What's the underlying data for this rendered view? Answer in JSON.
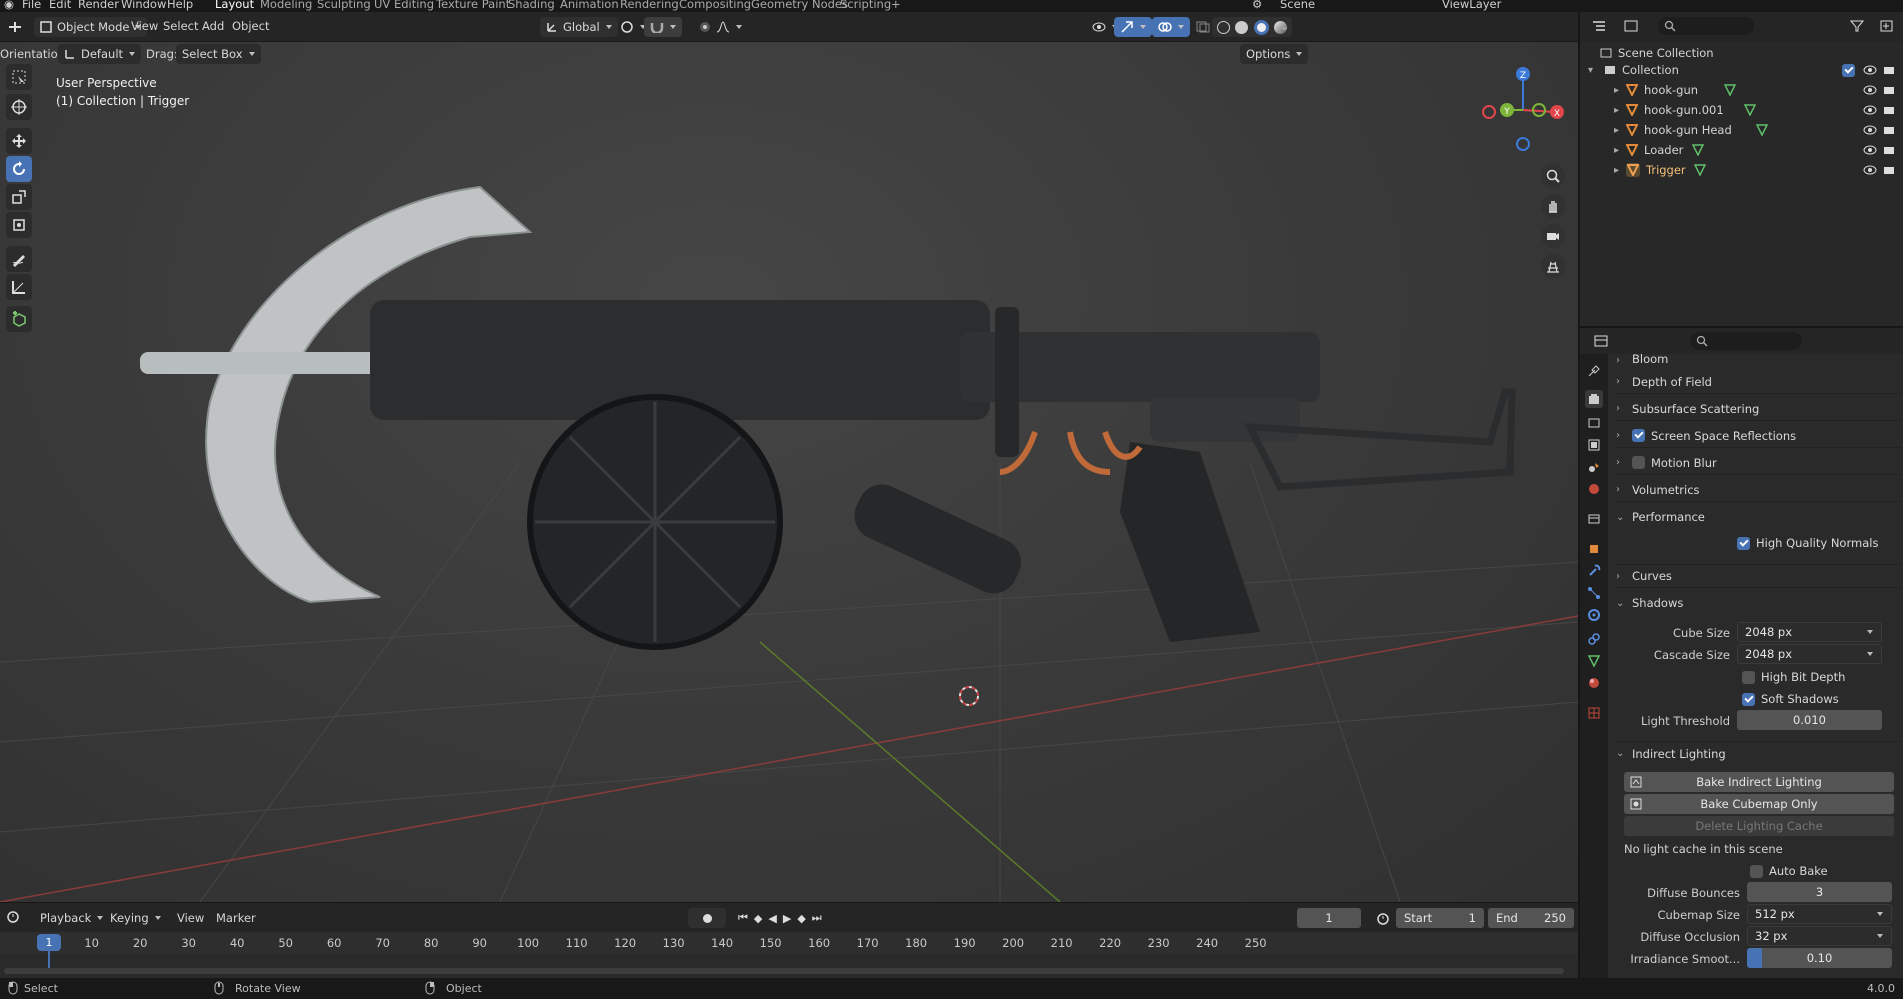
{
  "menu": {
    "items": [
      "File",
      "Edit",
      "Render",
      "Window",
      "Help"
    ],
    "workspaces": [
      "Layout",
      "Modeling",
      "Sculpting",
      "UV Editing",
      "Texture Paint",
      "Shading",
      "Animation",
      "Rendering",
      "Compositing",
      "Geometry Nodes",
      "Scripting"
    ],
    "active_workspace": "Layout",
    "add_tab": "+",
    "scene": "Scene",
    "view_layer": "ViewLayer"
  },
  "viewport_header": {
    "mode": "Object Mode",
    "menus": [
      "View",
      "Select",
      "Add",
      "Object"
    ],
    "transform_orientation": "Global",
    "orientation_label": "Orientation:",
    "orientation_value": "Default",
    "drag_label": "Drag:",
    "drag_value": "Select Box",
    "options": "Options"
  },
  "viewport": {
    "perspective": "User Perspective",
    "context": "(1) Collection | Trigger",
    "background": "#3b3b3b",
    "axes": {
      "x": "X",
      "y": "Y",
      "z": "Z"
    },
    "axis_colors": {
      "x": "#e0464a",
      "y": "#7db53a",
      "z": "#3b7ad8"
    }
  },
  "tools": [
    "select-box",
    "cursor",
    "move",
    "rotate",
    "scale",
    "transform",
    "annotate",
    "measure",
    "add-cube"
  ],
  "active_tool": "rotate",
  "outliner": {
    "root": "Scene Collection",
    "collection": "Collection",
    "objects": [
      "hook-gun",
      "hook-gun.001",
      "hook-gun Head",
      "Loader",
      "Trigger"
    ],
    "selected": "Trigger"
  },
  "properties": {
    "partial_section": "Bloom",
    "sections": [
      {
        "label": "Depth of Field",
        "open": false,
        "checkbox": null
      },
      {
        "label": "Subsurface Scattering",
        "open": false,
        "checkbox": null
      },
      {
        "label": "Screen Space Reflections",
        "open": false,
        "checkbox": true
      },
      {
        "label": "Motion Blur",
        "open": false,
        "checkbox": false
      },
      {
        "label": "Volumetrics",
        "open": false,
        "checkbox": null
      },
      {
        "label": "Performance",
        "open": true,
        "checkbox": null
      }
    ],
    "high_quality_normals": "High Quality Normals",
    "curves": "Curves",
    "shadows": {
      "label": "Shadows",
      "cube_size_label": "Cube Size",
      "cube_size": "2048 px",
      "cascade_size_label": "Cascade Size",
      "cascade_size": "2048 px",
      "high_bit_depth": "High Bit Depth",
      "soft_shadows": "Soft Shadows",
      "light_threshold_label": "Light Threshold",
      "light_threshold": "0.010"
    },
    "indirect": {
      "label": "Indirect Lighting",
      "bake": "Bake Indirect Lighting",
      "bake_cubemap": "Bake Cubemap Only",
      "delete_cache": "Delete Lighting Cache",
      "info": "No light cache in this scene",
      "auto_bake": "Auto Bake",
      "diffuse_bounces_label": "Diffuse Bounces",
      "diffuse_bounces": "3",
      "cubemap_size_label": "Cubemap Size",
      "cubemap_size": "512 px",
      "diffuse_occlusion_label": "Diffuse Occlusion",
      "diffuse_occlusion": "32 px",
      "irradiance_label": "Irradiance Smoot...",
      "irradiance": "0.10",
      "irradiance_fraction": 0.1
    }
  },
  "timeline": {
    "menus": [
      "Playback",
      "Keying",
      "View",
      "Marker"
    ],
    "current_frame": "1",
    "start_label": "Start",
    "start": "1",
    "end_label": "End",
    "end": "250",
    "ticks": [
      "1",
      "10",
      "20",
      "30",
      "40",
      "50",
      "60",
      "70",
      "80",
      "90",
      "100",
      "110",
      "120",
      "130",
      "140",
      "150",
      "160",
      "170",
      "180",
      "190",
      "200",
      "210",
      "220",
      "230",
      "240",
      "250"
    ]
  },
  "status": {
    "select": "Select",
    "rotate": "Rotate View",
    "object": "Object",
    "version": "4.0.0"
  }
}
